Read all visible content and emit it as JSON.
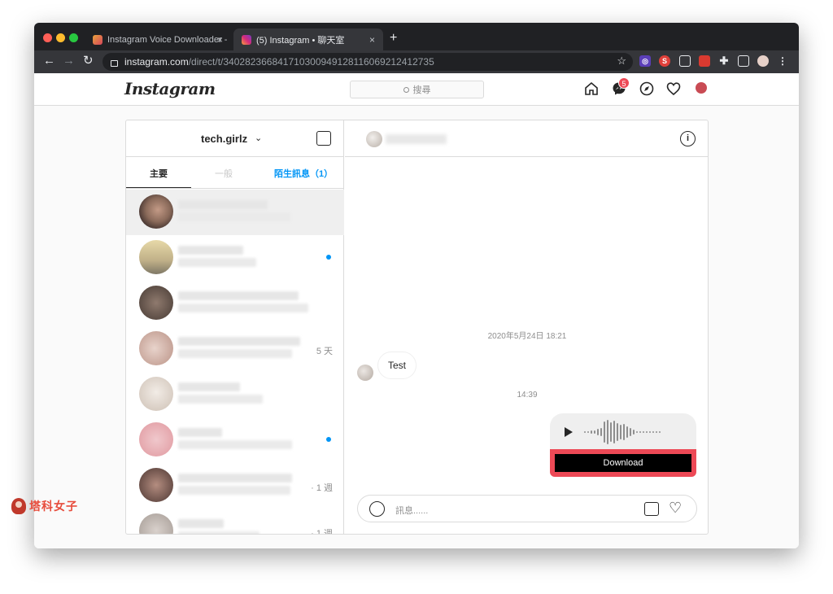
{
  "browser": {
    "tabs": [
      {
        "title": "Instagram Voice Downloader -",
        "active": false
      },
      {
        "title": "(5) Instagram • 聊天室",
        "active": true
      }
    ],
    "new_tab": "+",
    "close": "×",
    "url_host": "instagram.com",
    "url_path": "/direct/t/340282366841710300949128116069212412735"
  },
  "header": {
    "logo": "Instagram",
    "search_placeholder": "搜尋",
    "messenger_badge": "5"
  },
  "inbox": {
    "account": "tech.girlz",
    "tabs": [
      "主要",
      "一般",
      "陌生訊息（1）"
    ],
    "conversations": [
      {
        "meta": "",
        "unread": false
      },
      {
        "meta": "",
        "unread": true
      },
      {
        "meta": "",
        "unread": false
      },
      {
        "meta": "5 天",
        "unread": false
      },
      {
        "meta": "",
        "unread": false
      },
      {
        "meta": "",
        "unread": true
      },
      {
        "meta": "· 1 週",
        "unread": false
      },
      {
        "meta": "· 1 週",
        "unread": false
      }
    ]
  },
  "thread": {
    "timestamp_1": "2020年5月24日 18:21",
    "message_text": "Test",
    "timestamp_2": "14:39",
    "download_label": "Download",
    "composer_placeholder": "訊息......",
    "info": "i"
  },
  "watermark": "塔科女子",
  "colors": {
    "accent_blue": "#0095f6",
    "badge_red": "#ed4956",
    "highlight_red": "#ed4956"
  }
}
